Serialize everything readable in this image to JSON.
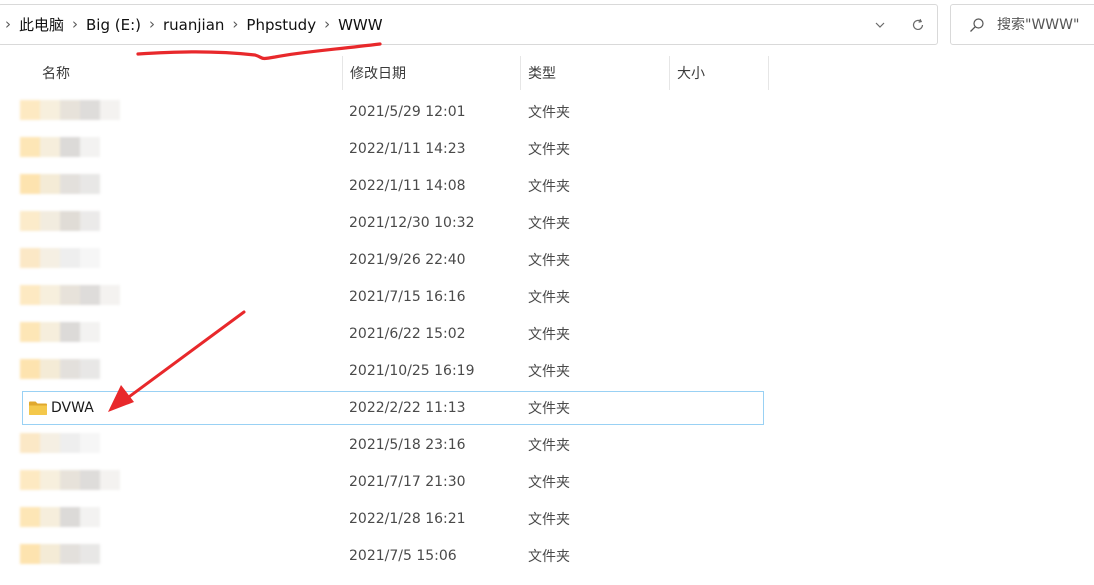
{
  "address_bar": {
    "breadcrumb": [
      "此电脑",
      "Big (E:)",
      "ruanjian",
      "Phpstudy",
      "WWW"
    ],
    "separator": "›"
  },
  "search": {
    "placeholder": "搜索\"WWW\""
  },
  "columns": {
    "name": "名称",
    "date": "修改日期",
    "type": "类型",
    "size": "大小"
  },
  "rows": [
    {
      "name": "",
      "date": "2021/5/29 12:01",
      "type": "文件夹"
    },
    {
      "name": "",
      "date": "2022/1/11 14:23",
      "type": "文件夹"
    },
    {
      "name": "",
      "date": "2022/1/11 14:08",
      "type": "文件夹"
    },
    {
      "name": "",
      "date": "2021/12/30 10:32",
      "type": "文件夹"
    },
    {
      "name": "",
      "date": "2021/9/26 22:40",
      "type": "文件夹"
    },
    {
      "name": "",
      "date": "2021/7/15 16:16",
      "type": "文件夹"
    },
    {
      "name": "",
      "date": "2021/6/22 15:02",
      "type": "文件夹"
    },
    {
      "name": "",
      "date": "2021/10/25 16:19",
      "type": "文件夹"
    },
    {
      "name": "DVWA",
      "date": "2022/2/22 11:13",
      "type": "文件夹",
      "selected": true
    },
    {
      "name": "",
      "date": "2021/5/18 23:16",
      "type": "文件夹"
    },
    {
      "name": "",
      "date": "2021/7/17 21:30",
      "type": "文件夹"
    },
    {
      "name": "",
      "date": "2022/1/28 16:21",
      "type": "文件夹"
    },
    {
      "name": "",
      "date": "2021/7/5 15:06",
      "type": "文件夹"
    }
  ],
  "colors": {
    "folder": "#f4c84b",
    "selection_border": "#99d1f4",
    "annotation": "#e8282b"
  },
  "icons": {
    "breadcrumb": "chevron-right-icon",
    "dropdown": "chevron-down-icon",
    "refresh": "refresh-icon",
    "search": "search-icon",
    "folder": "folder-icon"
  }
}
